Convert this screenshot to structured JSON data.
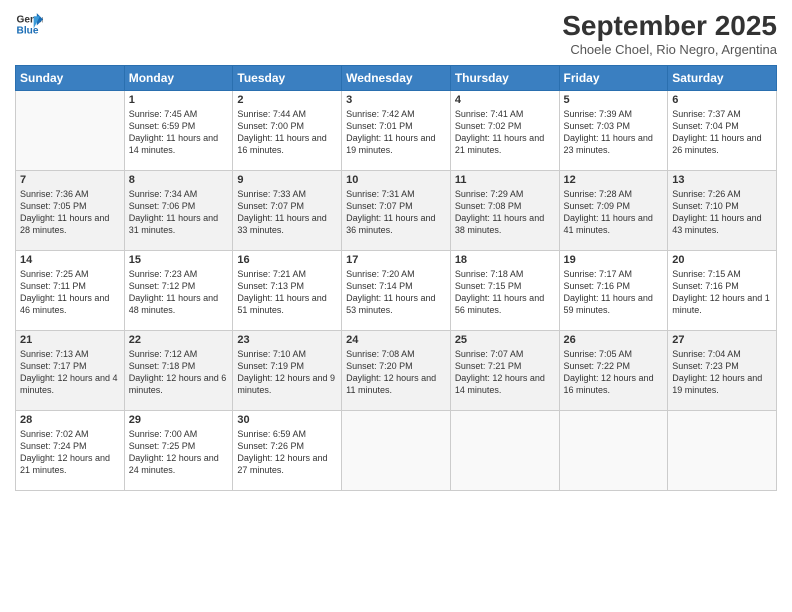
{
  "logo": {
    "line1": "General",
    "line2": "Blue"
  },
  "title": "September 2025",
  "location": "Choele Choel, Rio Negro, Argentina",
  "days_of_week": [
    "Sunday",
    "Monday",
    "Tuesday",
    "Wednesday",
    "Thursday",
    "Friday",
    "Saturday"
  ],
  "weeks": [
    [
      {
        "day": "",
        "empty": true
      },
      {
        "day": "1",
        "sunrise": "Sunrise: 7:45 AM",
        "sunset": "Sunset: 6:59 PM",
        "daylight": "Daylight: 11 hours and 14 minutes."
      },
      {
        "day": "2",
        "sunrise": "Sunrise: 7:44 AM",
        "sunset": "Sunset: 7:00 PM",
        "daylight": "Daylight: 11 hours and 16 minutes."
      },
      {
        "day": "3",
        "sunrise": "Sunrise: 7:42 AM",
        "sunset": "Sunset: 7:01 PM",
        "daylight": "Daylight: 11 hours and 19 minutes."
      },
      {
        "day": "4",
        "sunrise": "Sunrise: 7:41 AM",
        "sunset": "Sunset: 7:02 PM",
        "daylight": "Daylight: 11 hours and 21 minutes."
      },
      {
        "day": "5",
        "sunrise": "Sunrise: 7:39 AM",
        "sunset": "Sunset: 7:03 PM",
        "daylight": "Daylight: 11 hours and 23 minutes."
      },
      {
        "day": "6",
        "sunrise": "Sunrise: 7:37 AM",
        "sunset": "Sunset: 7:04 PM",
        "daylight": "Daylight: 11 hours and 26 minutes."
      }
    ],
    [
      {
        "day": "7",
        "sunrise": "Sunrise: 7:36 AM",
        "sunset": "Sunset: 7:05 PM",
        "daylight": "Daylight: 11 hours and 28 minutes."
      },
      {
        "day": "8",
        "sunrise": "Sunrise: 7:34 AM",
        "sunset": "Sunset: 7:06 PM",
        "daylight": "Daylight: 11 hours and 31 minutes."
      },
      {
        "day": "9",
        "sunrise": "Sunrise: 7:33 AM",
        "sunset": "Sunset: 7:07 PM",
        "daylight": "Daylight: 11 hours and 33 minutes."
      },
      {
        "day": "10",
        "sunrise": "Sunrise: 7:31 AM",
        "sunset": "Sunset: 7:07 PM",
        "daylight": "Daylight: 11 hours and 36 minutes."
      },
      {
        "day": "11",
        "sunrise": "Sunrise: 7:29 AM",
        "sunset": "Sunset: 7:08 PM",
        "daylight": "Daylight: 11 hours and 38 minutes."
      },
      {
        "day": "12",
        "sunrise": "Sunrise: 7:28 AM",
        "sunset": "Sunset: 7:09 PM",
        "daylight": "Daylight: 11 hours and 41 minutes."
      },
      {
        "day": "13",
        "sunrise": "Sunrise: 7:26 AM",
        "sunset": "Sunset: 7:10 PM",
        "daylight": "Daylight: 11 hours and 43 minutes."
      }
    ],
    [
      {
        "day": "14",
        "sunrise": "Sunrise: 7:25 AM",
        "sunset": "Sunset: 7:11 PM",
        "daylight": "Daylight: 11 hours and 46 minutes."
      },
      {
        "day": "15",
        "sunrise": "Sunrise: 7:23 AM",
        "sunset": "Sunset: 7:12 PM",
        "daylight": "Daylight: 11 hours and 48 minutes."
      },
      {
        "day": "16",
        "sunrise": "Sunrise: 7:21 AM",
        "sunset": "Sunset: 7:13 PM",
        "daylight": "Daylight: 11 hours and 51 minutes."
      },
      {
        "day": "17",
        "sunrise": "Sunrise: 7:20 AM",
        "sunset": "Sunset: 7:14 PM",
        "daylight": "Daylight: 11 hours and 53 minutes."
      },
      {
        "day": "18",
        "sunrise": "Sunrise: 7:18 AM",
        "sunset": "Sunset: 7:15 PM",
        "daylight": "Daylight: 11 hours and 56 minutes."
      },
      {
        "day": "19",
        "sunrise": "Sunrise: 7:17 AM",
        "sunset": "Sunset: 7:16 PM",
        "daylight": "Daylight: 11 hours and 59 minutes."
      },
      {
        "day": "20",
        "sunrise": "Sunrise: 7:15 AM",
        "sunset": "Sunset: 7:16 PM",
        "daylight": "Daylight: 12 hours and 1 minute."
      }
    ],
    [
      {
        "day": "21",
        "sunrise": "Sunrise: 7:13 AM",
        "sunset": "Sunset: 7:17 PM",
        "daylight": "Daylight: 12 hours and 4 minutes."
      },
      {
        "day": "22",
        "sunrise": "Sunrise: 7:12 AM",
        "sunset": "Sunset: 7:18 PM",
        "daylight": "Daylight: 12 hours and 6 minutes."
      },
      {
        "day": "23",
        "sunrise": "Sunrise: 7:10 AM",
        "sunset": "Sunset: 7:19 PM",
        "daylight": "Daylight: 12 hours and 9 minutes."
      },
      {
        "day": "24",
        "sunrise": "Sunrise: 7:08 AM",
        "sunset": "Sunset: 7:20 PM",
        "daylight": "Daylight: 12 hours and 11 minutes."
      },
      {
        "day": "25",
        "sunrise": "Sunrise: 7:07 AM",
        "sunset": "Sunset: 7:21 PM",
        "daylight": "Daylight: 12 hours and 14 minutes."
      },
      {
        "day": "26",
        "sunrise": "Sunrise: 7:05 AM",
        "sunset": "Sunset: 7:22 PM",
        "daylight": "Daylight: 12 hours and 16 minutes."
      },
      {
        "day": "27",
        "sunrise": "Sunrise: 7:04 AM",
        "sunset": "Sunset: 7:23 PM",
        "daylight": "Daylight: 12 hours and 19 minutes."
      }
    ],
    [
      {
        "day": "28",
        "sunrise": "Sunrise: 7:02 AM",
        "sunset": "Sunset: 7:24 PM",
        "daylight": "Daylight: 12 hours and 21 minutes."
      },
      {
        "day": "29",
        "sunrise": "Sunrise: 7:00 AM",
        "sunset": "Sunset: 7:25 PM",
        "daylight": "Daylight: 12 hours and 24 minutes."
      },
      {
        "day": "30",
        "sunrise": "Sunrise: 6:59 AM",
        "sunset": "Sunset: 7:26 PM",
        "daylight": "Daylight: 12 hours and 27 minutes."
      },
      {
        "day": "",
        "empty": true
      },
      {
        "day": "",
        "empty": true
      },
      {
        "day": "",
        "empty": true
      },
      {
        "day": "",
        "empty": true
      }
    ]
  ]
}
